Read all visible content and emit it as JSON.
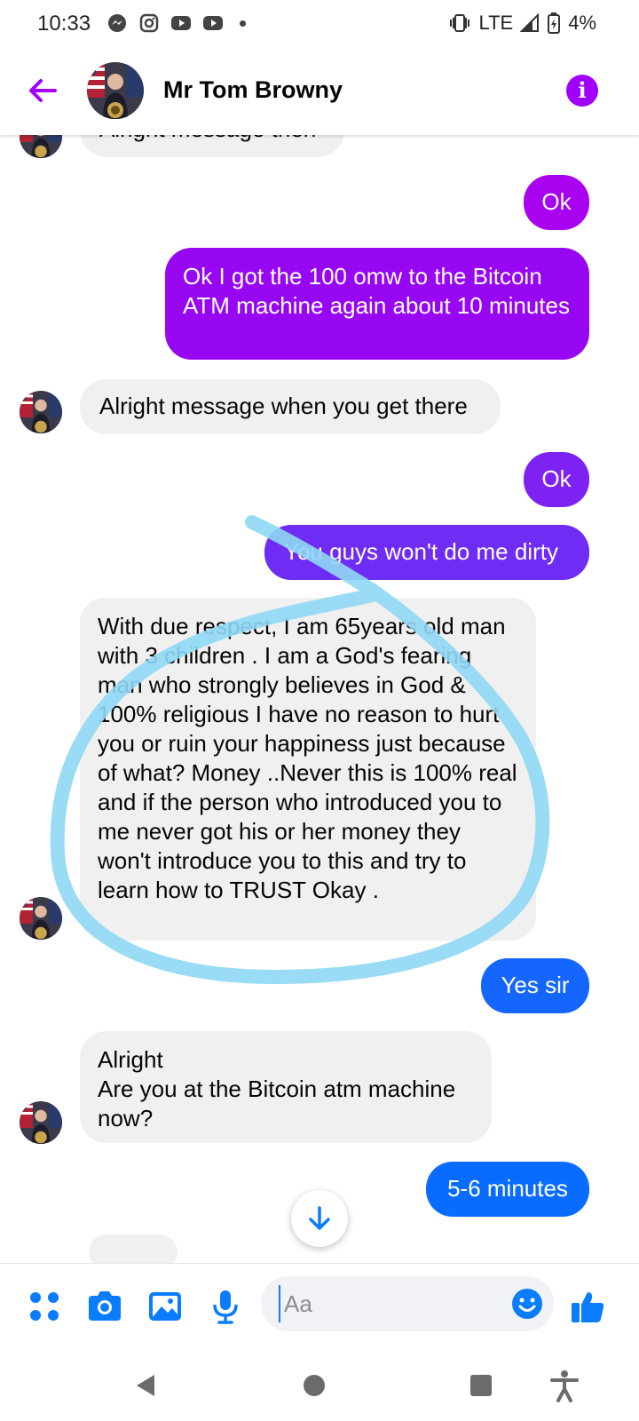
{
  "status_bar": {
    "time": "10:33",
    "network": "LTE",
    "battery": "4%"
  },
  "header": {
    "contact_name": "Mr Tom Browny"
  },
  "colors": {
    "accent": "#a100ff",
    "bubble_incoming": "#f0f0f0",
    "gradient_purple": "#a300f0",
    "gradient_violet": "#7b2ff7",
    "gradient_blue": "#0a6cff",
    "scribble": "#8fd8f4"
  },
  "messages": [
    {
      "side": "in",
      "text": "Alright message then"
    },
    {
      "side": "out",
      "text": "Ok"
    },
    {
      "side": "out",
      "text": "Ok I got the 100 omw to the Bitcoin ATM machine again about 10 minutes"
    },
    {
      "side": "in",
      "text": "Alright message when you get there"
    },
    {
      "side": "out",
      "text": "Ok"
    },
    {
      "side": "out",
      "text": "You guys won't do me dirty"
    },
    {
      "side": "in",
      "text": "With due respect, I am 65years  old man with 3 children . I am a God's fearing man who strongly believes in God & 100% religious I have no reason to hurt you or ruin your happiness just because of what? Money ..Never this is 100% real and if the person who introduced you to me never got his or her money they won't introduce you to this and try to learn how to TRUST Okay ."
    },
    {
      "side": "out",
      "text": "Yes sir"
    },
    {
      "side": "in",
      "text": "Alright\nAre you at the Bitcoin atm machine now?"
    },
    {
      "side": "out",
      "text": "5-6 minutes"
    }
  ],
  "composer": {
    "placeholder": "Aa"
  },
  "icons": {
    "back": "arrow-left-icon",
    "info": "info-icon",
    "menu": "grid-dots-icon",
    "camera": "camera-icon",
    "gallery": "image-icon",
    "mic": "microphone-icon",
    "emoji": "smiley-icon",
    "like": "thumbs-up-icon",
    "scroll": "arrow-down-icon",
    "nav_back": "triangle-back-icon",
    "nav_home": "circle-home-icon",
    "nav_recent": "square-recent-icon",
    "accessibility": "accessibility-icon"
  }
}
